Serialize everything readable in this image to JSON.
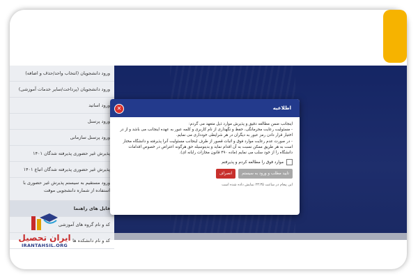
{
  "sidebar": {
    "items": [
      "ورود دانشجویان (انتخاب واحد/حذف و اضافه)",
      "ورود دانشجویان (پرداخت/سایر خدمات آموزشی)",
      "ورود اساتید",
      "ورود پرسنل",
      "ورود پرسنل سازمانی",
      "پذیرش غیر حضوری پذیرفته شدگان ۱۴۰۱",
      "پذیرش غیر حضوری پذیرفته شدگان اتباع ۱۴۰۱",
      "ورود مستقیم به سیستم پذیرش غیر حضوری با استفاده از شماره دانشجویی موقت",
      "فایل های راهنما",
      "کد و نام گروه های آموزشی",
      "کد و نام دانشکده ها"
    ]
  },
  "modal": {
    "title": "اطلاعیه",
    "paragraphs": [
      "اینجانب ضمن مطالعه دقیق و پذیرش موارد ذیل متعهد می گردم:",
      "- مسئولیت رعایت محرمانگی، حفظ و نگهداری از نام کاربری و کلمه عبور به عهده اینجانب می باشد و از در اختیار قرار دادن رمز عبور به دیگران در هر شرایطی خودداری می نمایم.",
      "- در صورت عدم رعایت موارد فوق و اثبات قصور از طرف اینجانب مسئولیت آنرا پذیرفته و دانشگاه مختار است به هر طریق ممکن نسبت به آن اقدام نماید و بدینوسیله حق هرگونه اعتراض در خصوص اقدامات دانشگاه را از خود سلب می نمایم (ماده ۴۹۰ قانون مجازات رایانه ای)."
    ],
    "checkbox_label": "موارد فوق را مطالعه کردم و پذیرفتم",
    "confirm_button": "تایید مطلب و ورود به سیستم",
    "cancel_button": "انصراف",
    "note": "این پیغام در ساعت ۲۳:۳۵ نمایش داده شده است"
  },
  "logo": {
    "name": "ایران تحصیل",
    "url": "IRANTAHSIL.ORG"
  },
  "colors": {
    "header_blue": "#233a8c",
    "cancel_red": "#c8302c",
    "accent_yellow": "#f6b300"
  }
}
